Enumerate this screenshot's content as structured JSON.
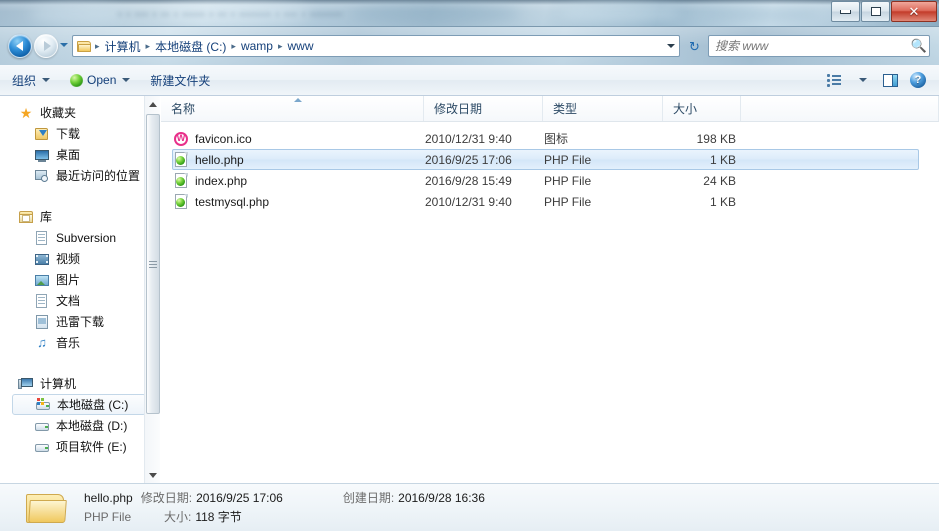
{
  "window": {
    "controls": {
      "minimize": "—",
      "maximize": "▭",
      "close": "✕"
    }
  },
  "address": {
    "back_icon": "back-arrow",
    "forward_icon": "forward-arrow",
    "history_icon": "chevron-down-icon",
    "folder_icon": "folder-icon",
    "crumbs": [
      "计算机",
      "本地磁盘 (C:)",
      "wamp",
      "www"
    ],
    "separator": "▸",
    "dropdown_icon": "chevron-down-icon",
    "refresh_icon": "↻"
  },
  "search": {
    "placeholder": "搜索 www",
    "value": "",
    "icon": "search-icon"
  },
  "toolbar": {
    "organize_label": "组织",
    "open_label": "Open",
    "new_folder_label": "新建文件夹",
    "view_icon": "view-options-icon",
    "pane_icon": "preview-pane-icon",
    "help_icon": "help-icon",
    "help_glyph": "?"
  },
  "sidebar": {
    "groups": [
      {
        "header": {
          "label": "收藏夹",
          "icon": "star-icon"
        },
        "items": [
          {
            "label": "下载",
            "icon": "download-icon"
          },
          {
            "label": "桌面",
            "icon": "desktop-icon"
          },
          {
            "label": "最近访问的位置",
            "icon": "recent-places-icon"
          }
        ]
      },
      {
        "header": {
          "label": "库",
          "icon": "library-icon"
        },
        "items": [
          {
            "label": "Subversion",
            "icon": "document-icon"
          },
          {
            "label": "视频",
            "icon": "video-icon"
          },
          {
            "label": "图片",
            "icon": "picture-icon"
          },
          {
            "label": "文档",
            "icon": "document-icon"
          },
          {
            "label": "迅雷下载",
            "icon": "thunder-download-icon"
          },
          {
            "label": "音乐",
            "icon": "music-icon"
          }
        ]
      },
      {
        "header": {
          "label": "计算机",
          "icon": "computer-icon"
        },
        "items": [
          {
            "label": "本地磁盘 (C:)",
            "icon": "system-drive-icon",
            "selected": true
          },
          {
            "label": "本地磁盘 (D:)",
            "icon": "drive-icon"
          },
          {
            "label": "项目软件 (E:)",
            "icon": "drive-icon"
          }
        ]
      }
    ],
    "scrollbar": {
      "up_icon": "scroll-up-arrow",
      "down_icon": "scroll-down-arrow"
    }
  },
  "filelist": {
    "columns": [
      "名称",
      "修改日期",
      "类型",
      "大小"
    ],
    "sort_column": "名称",
    "sort_direction": "asc",
    "rows": [
      {
        "name": "favicon.ico",
        "modified": "2010/12/31 9:40",
        "type": "图标",
        "size": "198 KB",
        "icon": "ico-file-icon",
        "selected": false
      },
      {
        "name": "hello.php",
        "modified": "2016/9/25 17:06",
        "type": "PHP File",
        "size": "1 KB",
        "icon": "php-file-icon",
        "selected": true
      },
      {
        "name": "index.php",
        "modified": "2016/9/28 15:49",
        "type": "PHP File",
        "size": "24 KB",
        "icon": "php-file-icon",
        "selected": false
      },
      {
        "name": "testmysql.php",
        "modified": "2010/12/31 9:40",
        "type": "PHP File",
        "size": "1 KB",
        "icon": "php-file-icon",
        "selected": false
      }
    ]
  },
  "details": {
    "icon": "folder-icon",
    "filename": "hello.php",
    "modified_label": "修改日期:",
    "modified_value": "2016/9/25 17:06",
    "created_label": "创建日期:",
    "created_value": "2016/9/28 16:36",
    "type_value": "PHP File",
    "size_label": "大小:",
    "size_value": "118 字节"
  },
  "colors": {
    "accent": "#15407a",
    "selection": "#dcebfa",
    "selection_border": "#a8c8e6",
    "close_red": "#c33c2a",
    "php_green": "#2f9a16",
    "ico_pink": "#e8308a"
  }
}
